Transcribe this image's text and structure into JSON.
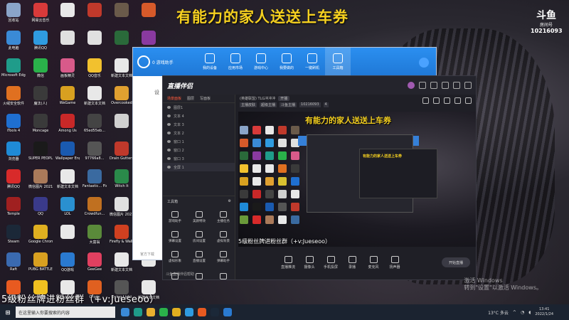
{
  "desktop": {
    "icons": [
      {
        "label": "回收站",
        "color": "#8aa4c8"
      },
      {
        "label": "网易云音乐",
        "color": "#d83a3a"
      },
      {
        "label": "",
        "color": "#e8e8e8"
      },
      {
        "label": "",
        "color": "#c0392b"
      },
      {
        "label": "",
        "color": "#6a5a4a"
      },
      {
        "label": "",
        "color": "#d65a2a"
      },
      {
        "label": "此电脑",
        "color": "#3a8ad6"
      },
      {
        "label": "腾讯QQ",
        "color": "#2f9be0"
      },
      {
        "label": "",
        "color": "#e0e0e0"
      },
      {
        "label": "",
        "color": "#e0e0e0"
      },
      {
        "label": "",
        "color": "#2a6a3a"
      },
      {
        "label": "",
        "color": "#8a3aa0"
      },
      {
        "label": "Microsoft Edge",
        "color": "#1f9c8a"
      },
      {
        "label": "微信",
        "color": "#2ab24a"
      },
      {
        "label": "画板精灵",
        "color": "#d85a8a"
      },
      {
        "label": "QQ音乐",
        "color": "#f2c12e"
      },
      {
        "label": "新建文本文档",
        "color": "#e8e8e8"
      },
      {
        "label": "",
        "color": "#e8e8e8"
      },
      {
        "label": "火绒安全软件",
        "color": "#e07020"
      },
      {
        "label": "魔法(人)",
        "color": "#3a3a3a"
      },
      {
        "label": "WeGame",
        "color": "#d8a020"
      },
      {
        "label": "新建文本文档",
        "color": "#e8e8e8"
      },
      {
        "label": "Overcooked",
        "color": "#e0a030"
      },
      {
        "label": "Escape Simulator",
        "color": "#d8c030"
      },
      {
        "label": "iTools 4",
        "color": "#1f6fd0"
      },
      {
        "label": "Moncage",
        "color": "#3a3a3a"
      },
      {
        "label": "Among Us",
        "color": "#c82828"
      },
      {
        "label": "65ed55eb...",
        "color": "#444"
      },
      {
        "label": "",
        "color": "#d0d0d0"
      },
      {
        "label": "新建文本文档",
        "color": "#e8e8e8"
      },
      {
        "label": "浏览器",
        "color": "#1f8ad6"
      },
      {
        "label": "SUPER PEOPLE CBT",
        "color": "#1a1a1a"
      },
      {
        "label": "Wallpaper Engine",
        "color": "#1a5ab0"
      },
      {
        "label": "97766a8...",
        "color": "#555"
      },
      {
        "label": "Drain Gutters...",
        "color": "#c0392b"
      },
      {
        "label": "Nature Cat",
        "color": "#6a9a3a"
      },
      {
        "label": "腾讯QQ",
        "color": "#d82a2a"
      },
      {
        "label": "微信图片 2021093...",
        "color": "#aa7a5a"
      },
      {
        "label": "新建文本文档",
        "color": "#e8e8e8"
      },
      {
        "label": "Fantastic... Fishing",
        "color": "#3a6aa0"
      },
      {
        "label": "Witch It",
        "color": "#2a8a4a"
      },
      {
        "label": "SCP Shelter",
        "color": "#333"
      },
      {
        "label": "Temple",
        "color": "#a02020"
      },
      {
        "label": "QQ",
        "color": "#3a3a8a"
      },
      {
        "label": "LOL",
        "color": "#2a90d0"
      },
      {
        "label": "Crowdfun...",
        "color": "#c07020"
      },
      {
        "label": "微信图片 2021...",
        "color": "#e0e0e0"
      },
      {
        "label": "",
        "color": "#e0e0e0"
      },
      {
        "label": "Steam",
        "color": "#1b2838"
      },
      {
        "label": "Google Chrome",
        "color": "#e0b020"
      },
      {
        "label": "",
        "color": "#e8e8e8"
      },
      {
        "label": "大富翁",
        "color": "#5a8a3a"
      },
      {
        "label": "Firefly & Walkingm...",
        "color": "#d04020"
      },
      {
        "label": "Super Bunny Man",
        "color": "#a02a8a"
      },
      {
        "label": "Raft",
        "color": "#3a6ab0"
      },
      {
        "label": "PUBG BATTLEGR...",
        "color": "#d8a020"
      },
      {
        "label": "QQ游戏",
        "color": "#2a7ad0"
      },
      {
        "label": "GeeGee",
        "color": "#e04060"
      },
      {
        "label": "新建文本文档",
        "color": "#e8e8e8"
      },
      {
        "label": "",
        "color": "#e8e8e8"
      },
      {
        "label": "斗鱼直播",
        "color": "#e85a20"
      },
      {
        "label": "YY语音",
        "color": "#f0c020"
      },
      {
        "label": "新建文本文档",
        "color": "#e8e8e8"
      },
      {
        "label": "Origin",
        "color": "#e06020"
      },
      {
        "label": "Dying Light",
        "color": "#555"
      },
      {
        "label": "新建文本文档",
        "color": "#e8e8e8"
      }
    ]
  },
  "banner": "有能力的家人送送上车券",
  "room": {
    "logo": "斗鱼",
    "sub": "房间号",
    "number": "10216093"
  },
  "assistant": {
    "brand": "0 游戏助手",
    "tabs": [
      "我的设备",
      "应用市场",
      "游戏中心",
      "我要做的",
      "一键刷机",
      "工具箱"
    ],
    "side_label": "设",
    "bottom": "官方下载"
  },
  "streamer": {
    "logo": "直播伴侣",
    "tabs": [
      "场景面板",
      "图层",
      "写面板"
    ],
    "layers": [
      "图层1",
      "文本 4",
      "文本 3",
      "文本 2",
      "窗口 1",
      "窗口 2",
      "窗口 3",
      "全屏 1"
    ],
    "tools_header": "工具箱",
    "tools": [
      "游戏助手",
      "美颜特效",
      "主播任务",
      "弹幕设置",
      "房间设置",
      "虚拟背景",
      "虚拟形象",
      "直播设置",
      "弹幕助手",
      "",
      "",
      ""
    ],
    "footer": "斗鱼直播伴侣帮助",
    "info_title": "(英雄联盟) TLG冲冲冲",
    "info_badge": "开播",
    "info_row2": [
      "主播皮肤",
      "超级主播",
      "斗鱼主播",
      "10216093",
      "4"
    ],
    "preview_caption": "5级粉丝牌进粉丝群（+v:Jueseoo）",
    "controls": [
      "直播推流",
      "摄像头",
      "手机投屏",
      "录播",
      "麦克风",
      "扬声器"
    ],
    "golive": "开始直播"
  },
  "fanline": "5级粉丝牌进粉丝群（+v:Jueseoo）",
  "activate": [
    "激活 Windows",
    "转到\"设置\"以激活 Windows。"
  ],
  "taskbar": {
    "start": "⊞",
    "search": "在这里输入你要搜索的内容",
    "weather": "13°C 多云",
    "time": "13:41",
    "date": "2022/1/24"
  }
}
